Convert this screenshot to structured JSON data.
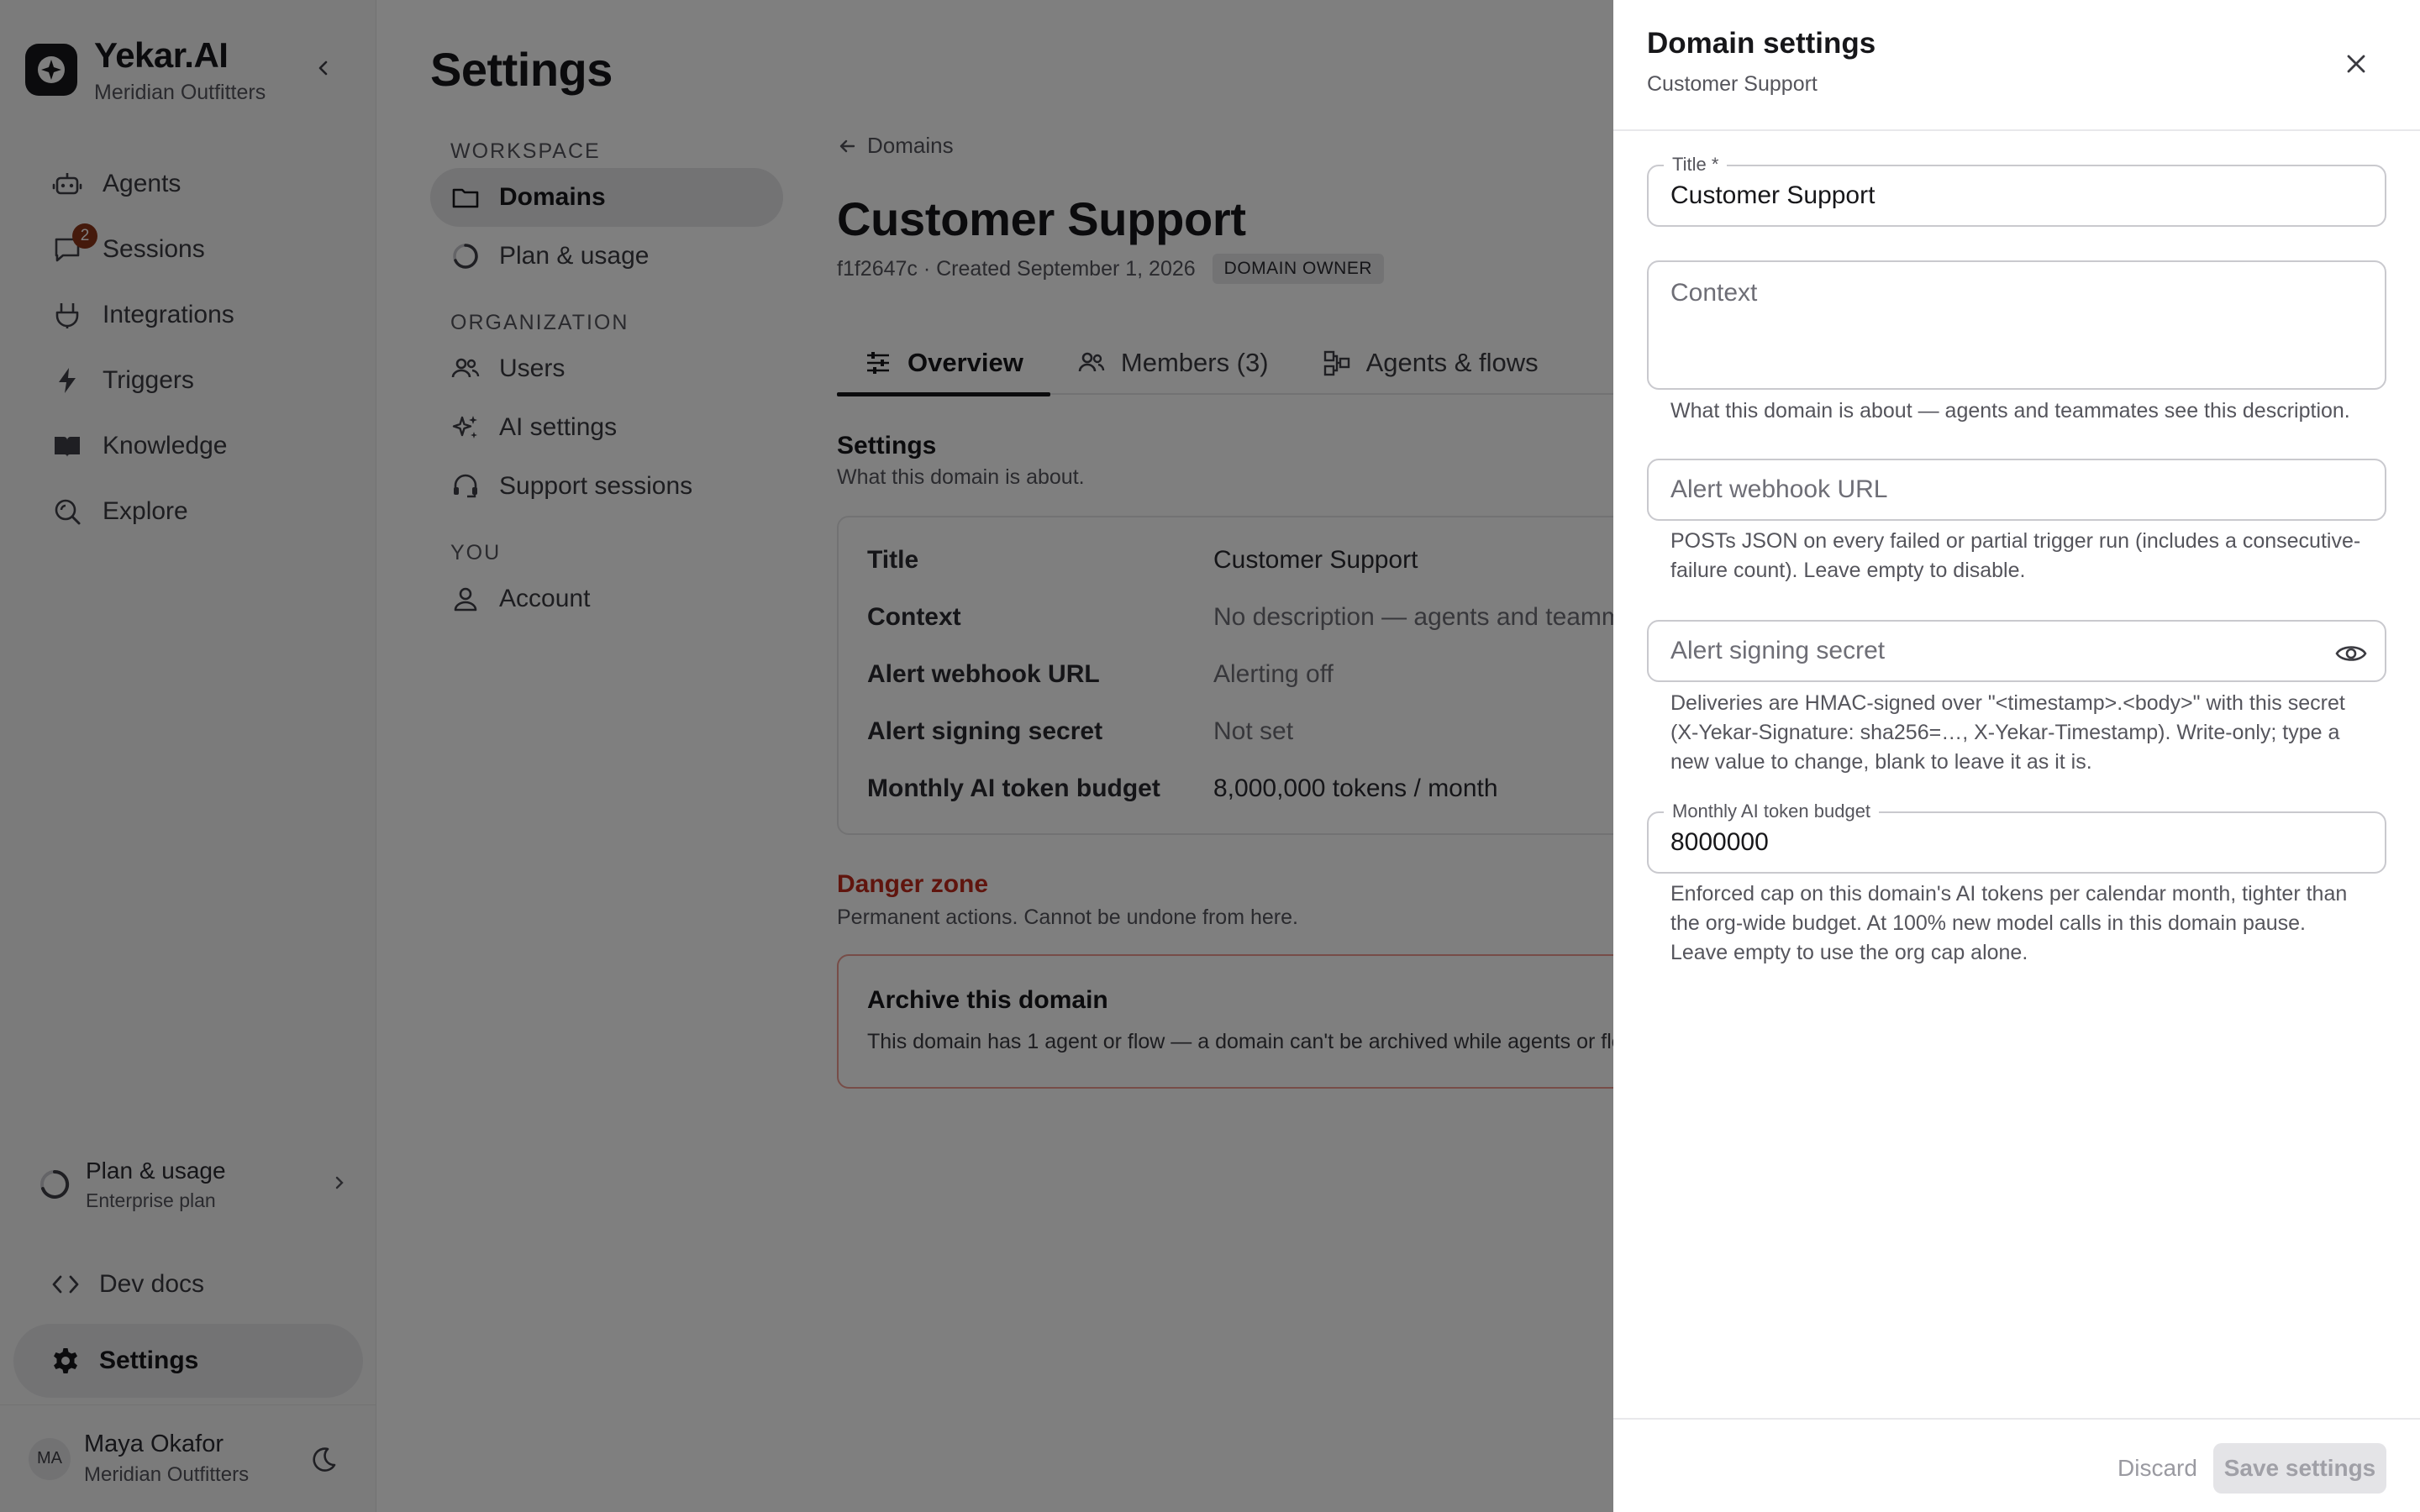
{
  "app": {
    "brand_name": "Yekar.AI",
    "org_name": "Meridian Outfitters",
    "accent": "#17171a",
    "badge_color": "#8a3418",
    "danger_color": "#c02a1c"
  },
  "sidebar": {
    "items": [
      {
        "label": "Agents",
        "icon": "robot-icon"
      },
      {
        "label": "Sessions",
        "icon": "chat-icon",
        "badge": "2"
      },
      {
        "label": "Integrations",
        "icon": "plug-icon"
      },
      {
        "label": "Triggers",
        "icon": "bolt-icon"
      },
      {
        "label": "Knowledge",
        "icon": "book-icon"
      },
      {
        "label": "Explore",
        "icon": "explore-icon"
      }
    ],
    "plan": {
      "title": "Plan & usage",
      "subtitle": "Enterprise plan"
    },
    "dev_docs": "Dev docs",
    "settings": "Settings",
    "user": {
      "initials": "MA",
      "name": "Maya Okafor",
      "org": "Meridian Outfitters"
    }
  },
  "settings_page": {
    "title": "Settings",
    "sections": [
      {
        "heading": "WORKSPACE",
        "items": [
          {
            "label": "Domains",
            "active": true
          },
          {
            "label": "Plan & usage"
          }
        ]
      },
      {
        "heading": "ORGANIZATION",
        "items": [
          {
            "label": "Users"
          },
          {
            "label": "AI settings"
          },
          {
            "label": "Support sessions"
          }
        ]
      },
      {
        "heading": "YOU",
        "items": [
          {
            "label": "Account"
          }
        ]
      }
    ]
  },
  "domain": {
    "back_label": "Domains",
    "title": "Customer Support",
    "meta": "f1f2647c · Created September 1, 2026",
    "role_badge": "DOMAIN OWNER",
    "tabs": [
      {
        "label": "Overview",
        "active": true
      },
      {
        "label": "Members (3)"
      },
      {
        "label": "Agents & flows"
      }
    ],
    "settings_heading": "Settings",
    "settings_sub": "What this domain is about.",
    "rows": [
      {
        "key": "Title",
        "value": "Customer Support"
      },
      {
        "key": "Context",
        "value": "No description — agents and teamm"
      },
      {
        "key": "Alert webhook URL",
        "value": "Alerting off"
      },
      {
        "key": "Alert signing secret",
        "value": "Not set"
      },
      {
        "key": "Monthly AI token budget",
        "value": "8,000,000 tokens / month"
      }
    ],
    "danger_heading": "Danger zone",
    "danger_sub": "Permanent actions. Cannot be undone from here.",
    "archive_title": "Archive this domain",
    "archive_desc": "This domain has 1 agent or flow — a domain can't be archived while agents or flo"
  },
  "drawer": {
    "title": "Domain settings",
    "subtitle": "Customer Support",
    "title_field": {
      "label": "Title *",
      "value": "Customer Support"
    },
    "context_field": {
      "placeholder": "Context",
      "helper": "What this domain is about — agents and teammates see this description."
    },
    "webhook_field": {
      "placeholder": "Alert webhook URL",
      "helper": "POSTs JSON on every failed or partial trigger run (includes a consecutive-failure count). Leave empty to disable."
    },
    "secret_field": {
      "placeholder": "Alert signing secret",
      "helper": "Deliveries are HMAC-signed over \"<timestamp>.<body>\" with this secret (X-Yekar-Signature: sha256=…, X-Yekar-Timestamp). Write-only; type a new value to change, blank to leave it as it is."
    },
    "budget_field": {
      "label": "Monthly AI token budget",
      "value": "8000000",
      "helper": "Enforced cap on this domain's AI tokens per calendar month, tighter than the org-wide budget. At 100% new model calls in this domain pause. Leave empty to use the org cap alone."
    },
    "discard_label": "Discard",
    "save_label": "Save settings"
  }
}
